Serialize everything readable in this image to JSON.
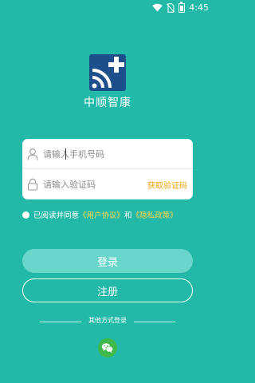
{
  "status_bar": {
    "time": "4:45",
    "icons": [
      "wifi-icon",
      "sim-no-signal-icon",
      "battery-icon"
    ]
  },
  "app": {
    "name": "中顺智康",
    "logo_icon": "signal-plus-logo",
    "brand_color": "#23b9a8",
    "logo_color": "#1d4f8c"
  },
  "login_form": {
    "phone_placeholder": "请输入手机号码",
    "code_placeholder": "请输入验证码",
    "get_code_label": "获取验证码",
    "phone_icon": "user-icon",
    "code_icon": "lock-icon"
  },
  "agreement": {
    "prefix": "已阅读并同意",
    "user_agreement": "《用户协议》",
    "and": "和",
    "privacy_policy": "《隐私政策》",
    "link_color": "#ffd84a"
  },
  "buttons": {
    "login": "登录",
    "register": "注册"
  },
  "other_login": {
    "label": "其他方式登录",
    "icon": "wechat-icon"
  }
}
